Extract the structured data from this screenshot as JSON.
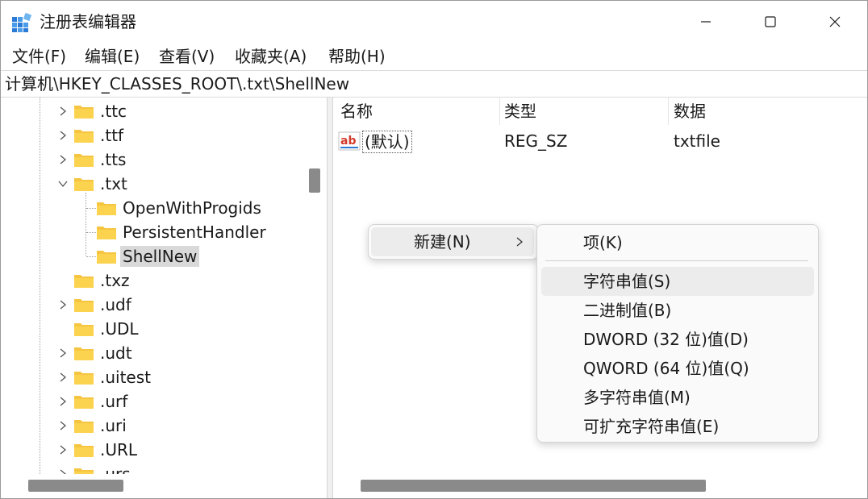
{
  "window": {
    "title": "注册表编辑器"
  },
  "menubar": [
    {
      "label": "文件(F)"
    },
    {
      "label": "编辑(E)"
    },
    {
      "label": "查看(V)"
    },
    {
      "label": "收藏夹(A)"
    },
    {
      "label": "帮助(H)"
    }
  ],
  "address": {
    "path": "计算机\\HKEY_CLASSES_ROOT\\.txt\\ShellNew"
  },
  "tree": {
    "items": [
      {
        "label": ".ttc",
        "state": "collapsed"
      },
      {
        "label": ".ttf",
        "state": "collapsed"
      },
      {
        "label": ".tts",
        "state": "collapsed"
      },
      {
        "label": ".txt",
        "state": "expanded"
      },
      {
        "label": "OpenWithProgids",
        "state": "leaf",
        "child": true
      },
      {
        "label": "PersistentHandler",
        "state": "leaf",
        "child": true
      },
      {
        "label": "ShellNew",
        "state": "leaf",
        "child": true,
        "selected": true
      },
      {
        "label": ".txz",
        "state": "leaf"
      },
      {
        "label": ".udf",
        "state": "collapsed"
      },
      {
        "label": ".UDL",
        "state": "leaf"
      },
      {
        "label": ".udt",
        "state": "collapsed"
      },
      {
        "label": ".uitest",
        "state": "collapsed"
      },
      {
        "label": ".urf",
        "state": "collapsed"
      },
      {
        "label": ".uri",
        "state": "collapsed"
      },
      {
        "label": ".URL",
        "state": "collapsed"
      },
      {
        "label": ".urs",
        "state": "collapsed"
      }
    ]
  },
  "list": {
    "columns": [
      "名称",
      "类型",
      "数据"
    ],
    "rows": [
      {
        "name": "(默认)",
        "type": "REG_SZ",
        "data": "txtfile",
        "icon": "string-value-icon"
      }
    ]
  },
  "context_menu": {
    "new_label": "新建(N)",
    "submenu": [
      {
        "label": "项(K)"
      },
      {
        "label": "字符串值(S)",
        "hover": true
      },
      {
        "label": "二进制值(B)"
      },
      {
        "label": "DWORD (32 位)值(D)"
      },
      {
        "label": "QWORD (64 位)值(Q)"
      },
      {
        "label": "多字符串值(M)"
      },
      {
        "label": "可扩充字符串值(E)"
      }
    ]
  },
  "colors": {
    "folder": "#f5c542",
    "selection": "#d9d9d9",
    "menu_hover": "#ececec",
    "icon_blue": "#2b7bd6"
  }
}
